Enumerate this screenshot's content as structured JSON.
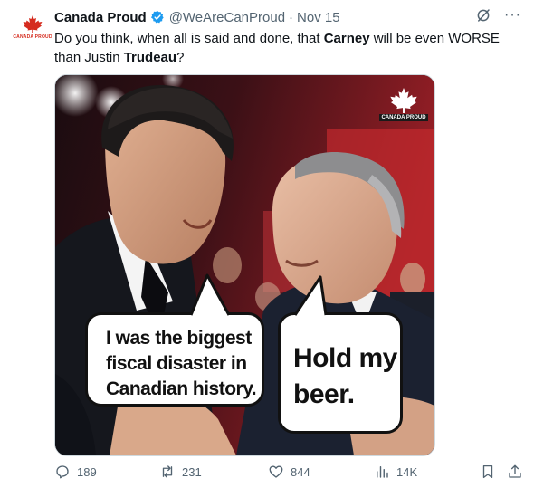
{
  "tweet": {
    "avatar_brand": "CANADA PROUD",
    "display_name": "Canada Proud",
    "handle": "@WeAreCanProud",
    "separator": "·",
    "time": "Nov 15",
    "more_label": "···",
    "text_parts": {
      "p1": "Do you think, when all is said and done, that ",
      "b1": "Carney",
      "p2": " will be even WORSE than Justin ",
      "b2": "Trudeau",
      "p3": "?"
    }
  },
  "media": {
    "logo_text": "CANADA PROUD",
    "bubble_left_lines": [
      "I was the biggest",
      "fiscal disaster in",
      "Canadian history."
    ],
    "bubble_right_lines": [
      "Hold my",
      "beer."
    ]
  },
  "actions": {
    "replies": "189",
    "reposts": "231",
    "likes": "844",
    "views": "14K"
  },
  "colors": {
    "brand_red": "#d52b1e",
    "verified_blue": "#1d9bf0",
    "muted_text": "#536471"
  }
}
